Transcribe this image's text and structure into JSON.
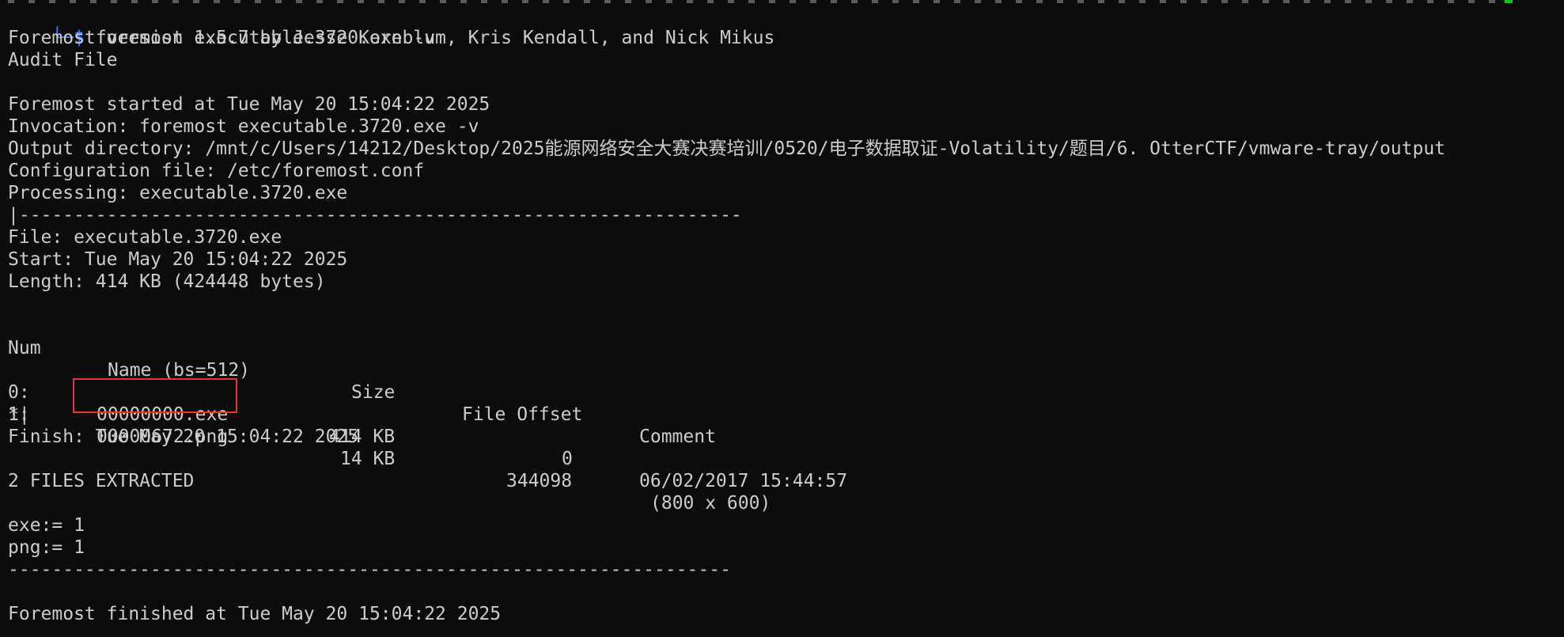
{
  "prompt": {
    "corner": "└─",
    "symbol": "$",
    "command": "foremost executable.3720.exe -v"
  },
  "output": {
    "version_line": "Foremost version 1.5.7 by Jesse Kornblum, Kris Kendall, and Nick Mikus",
    "audit_line": "Audit File",
    "started_line": "Foremost started at Tue May 20 15:04:22 2025",
    "invocation_line": "Invocation: foremost executable.3720.exe -v",
    "output_dir_line": "Output directory: /mnt/c/Users/14212/Desktop/2025能源网络安全大赛决赛培训/0520/电子数据取证-Volatility/题目/6. OtterCTF/vmware-tray/output",
    "config_line": "Configuration file: /etc/foremost.conf",
    "processing_line": "Processing: executable.3720.exe",
    "separator_top": "|------------------------------------------------------------------",
    "file_line": "File: executable.3720.exe",
    "start_line": "Start: Tue May 20 15:04:22 2025",
    "length_line": "Length: 414 KB (424448 bytes)",
    "finish_line": "Finish: Tue May 20 15:04:22 2025",
    "extracted_line": "2 FILES EXTRACTED",
    "exe_count_line": "exe:= 1",
    "png_count_line": "png:= 1",
    "separator_bottom": "------------------------------------------------------------------",
    "finished_line": "Foremost finished at Tue May 20 15:04:22 2025",
    "cursor_line": "*|"
  },
  "table": {
    "headers": {
      "num": "Num",
      "name": "Name (bs=512)",
      "size": "Size",
      "offset": "File Offset",
      "comment": "Comment"
    },
    "rows": [
      {
        "num": "0:",
        "name": "00000000.exe",
        "size": "414 KB",
        "offset": "0",
        "comment": "06/02/2017 15:44:57"
      },
      {
        "num": "1:",
        "name": "00000672.png",
        "size": "14 KB",
        "offset": "344098",
        "comment": "(800 x 600)"
      }
    ]
  },
  "colors": {
    "background": "#0c0c0c",
    "text": "#cccccc",
    "prompt": "#3b78ff",
    "highlight_box": "#e8352e"
  }
}
